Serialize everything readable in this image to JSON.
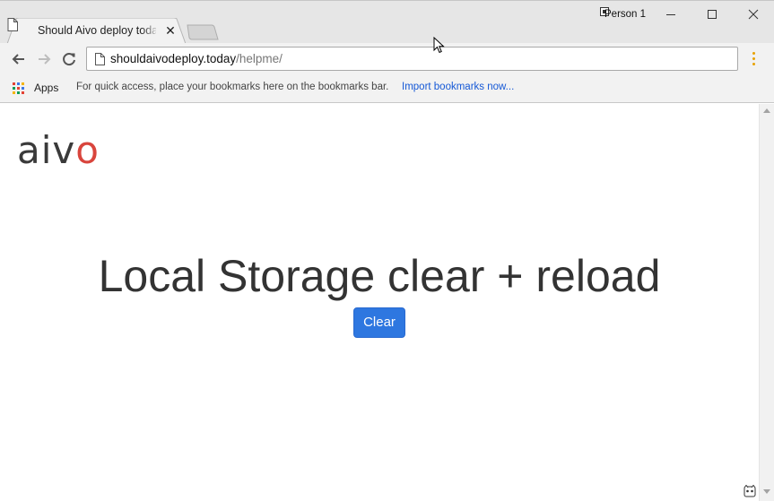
{
  "browser": {
    "tab": {
      "title": "Should Aivo deploy today?"
    },
    "profile": {
      "name": "Person 1"
    },
    "address_bar": {
      "host": "shouldaivodeploy.today",
      "path": "/helpme/"
    },
    "bookmarks_bar": {
      "apps_label": "Apps",
      "hint": "For quick access, place your bookmarks here on the bookmarks bar.",
      "import_link": "Import bookmarks now..."
    },
    "colors": {
      "menu_dots": "#e8a100",
      "link": "#1558d6"
    }
  },
  "page": {
    "logo": {
      "prefix": "aiv",
      "suffix": "o",
      "text_color": "#3a3a3a",
      "accent_color": "#d9453d"
    },
    "heading": "Local Storage clear + reload",
    "clear_button": {
      "label": "Clear",
      "color": "#2e77e0"
    }
  }
}
